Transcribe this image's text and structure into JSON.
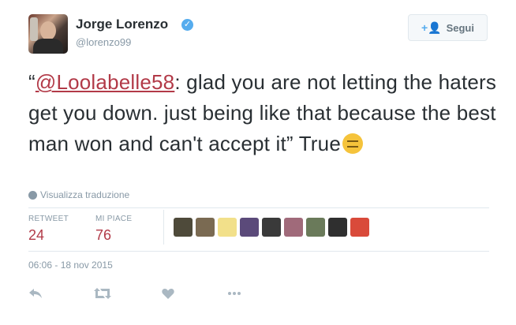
{
  "author": {
    "name": "Jorge Lorenzo",
    "handle": "@lorenzo99",
    "verified_icon": "verified-badge-icon"
  },
  "follow_button": {
    "label": "Segui",
    "icon": "add-user-icon"
  },
  "tweet": {
    "mention": "@Loolabelle58",
    "text_before": "“",
    "text_after": ": glad you are not letting the haters get you down. just being like that because the best man won and can't accept it” True",
    "emoji": "expressionless-face-emoji"
  },
  "translate": {
    "label": "Visualizza traduzione",
    "icon": "globe-icon"
  },
  "stats": {
    "retweet_label": "RETWEET",
    "retweet_count": "24",
    "likes_label": "MI PIACE",
    "likes_count": "76"
  },
  "liker_avatars": [
    "#4e4a3a",
    "#7a6a52",
    "#f2e08a",
    "#5b4a7a",
    "#3a3a3a",
    "#a06a7a",
    "#6a7a5a",
    "#2f2f2f",
    "#d94a3a"
  ],
  "timestamp": "06:06 - 18 nov 2015",
  "actions": {
    "reply_icon": "reply-icon",
    "retweet_icon": "retweet-icon",
    "like_icon": "heart-icon",
    "more_icon": "more-icon"
  },
  "colors": {
    "link": "#b23a48",
    "muted": "#8899a6",
    "verified": "#55acee"
  }
}
